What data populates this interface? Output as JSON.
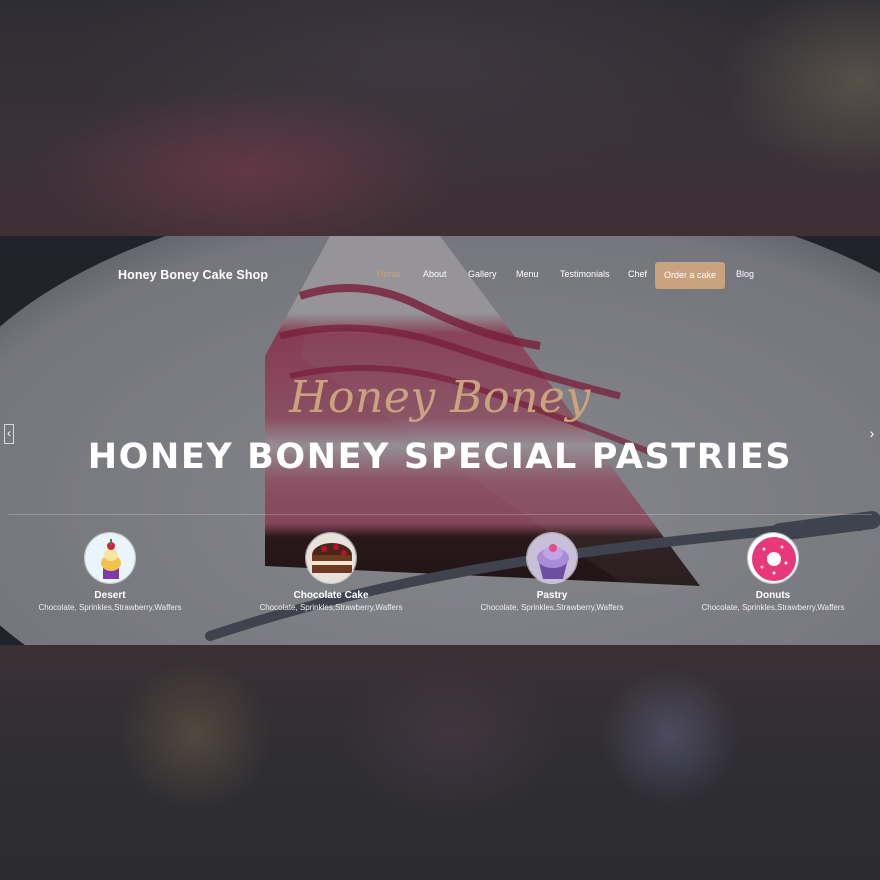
{
  "brand": "Honey Boney Cake Shop",
  "nav": {
    "items": [
      "Home",
      "About",
      "Gallery",
      "Menu",
      "Testimonials",
      "Chef"
    ],
    "active": "Home",
    "cta": "Order a cake",
    "last": "Blog"
  },
  "hero": {
    "script_title": "Honey Boney",
    "main_title": "HONEY BONEY SPECIAL PASTRIES",
    "prev_icon": "‹",
    "next_icon": "›"
  },
  "categories": [
    {
      "name": "Desert",
      "desc": "Chocolate, Sprinkles,Strawberry,Waffers",
      "icon": "dessert-cup-icon"
    },
    {
      "name": "Chocolate Cake",
      "desc": "Chocolate, Sprinkles,Strawberry,Waffers",
      "icon": "chocolate-cake-icon"
    },
    {
      "name": "Pastry",
      "desc": "Chocolate, Sprinkles,Strawberry,Waffers",
      "icon": "cupcake-icon"
    },
    {
      "name": "Donuts",
      "desc": "Chocolate, Sprinkles,Strawberry,Waffers",
      "icon": "donut-icon"
    }
  ],
  "colors": {
    "accent": "#c9a27e",
    "text": "#ffffff",
    "overlay": "#232428"
  }
}
